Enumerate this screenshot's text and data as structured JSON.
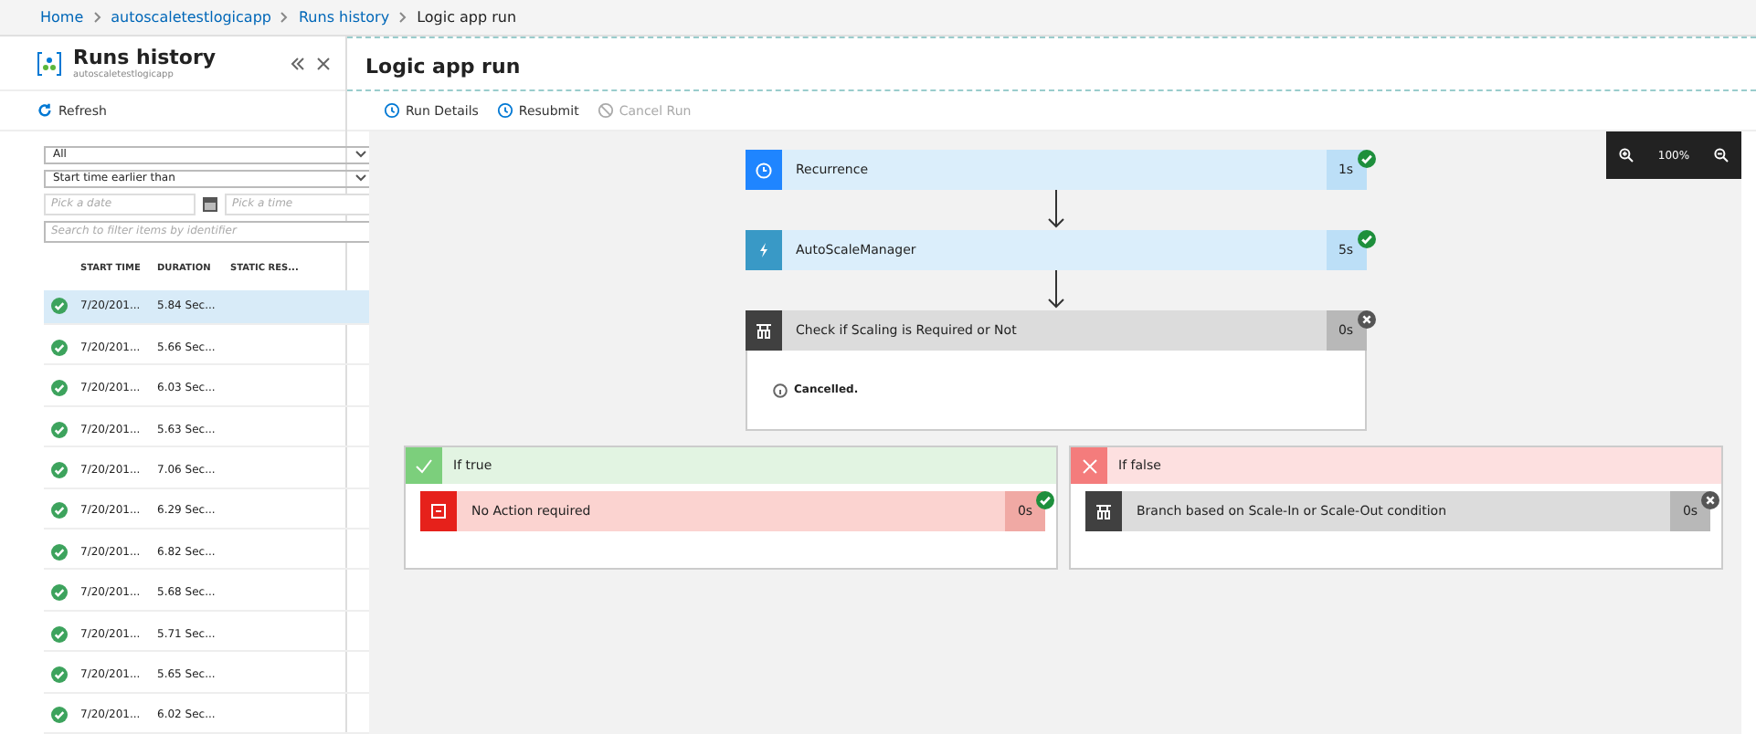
{
  "breadcrumb": [
    "Home",
    "autoscaletestlogicapp",
    "Runs history",
    "Logic app run"
  ],
  "left": {
    "title": "Runs history",
    "subtitle": "autoscaletestlogicapp",
    "refresh": "Refresh",
    "status_filter": "All",
    "time_filter": "Start time earlier than",
    "date_placeholder": "Pick a date",
    "time_placeholder": "Pick a time",
    "search_placeholder": "Search to filter items by identifier",
    "columns": [
      "START TIME",
      "DURATION",
      "STATIC RES..."
    ],
    "runs": [
      {
        "start": "7/20/201...",
        "duration": "5.84 Sec...",
        "selected": true
      },
      {
        "start": "7/20/201...",
        "duration": "5.66 Sec...",
        "selected": false
      },
      {
        "start": "7/20/201...",
        "duration": "6.03 Sec...",
        "selected": false
      },
      {
        "start": "7/20/201...",
        "duration": "5.63 Sec...",
        "selected": false
      },
      {
        "start": "7/20/201...",
        "duration": "7.06 Sec...",
        "selected": false
      },
      {
        "start": "7/20/201...",
        "duration": "6.29 Sec...",
        "selected": false
      },
      {
        "start": "7/20/201...",
        "duration": "6.82 Sec...",
        "selected": false
      },
      {
        "start": "7/20/201...",
        "duration": "5.68 Sec...",
        "selected": false
      },
      {
        "start": "7/20/201...",
        "duration": "5.71 Sec...",
        "selected": false
      },
      {
        "start": "7/20/201...",
        "duration": "5.65 Sec...",
        "selected": false
      },
      {
        "start": "7/20/201...",
        "duration": "6.02 Sec...",
        "selected": false
      }
    ]
  },
  "main": {
    "title": "Logic app run",
    "toolbar": [
      {
        "label": "Run Details",
        "disabled": false
      },
      {
        "label": "Resubmit",
        "disabled": false
      },
      {
        "label": "Cancel Run",
        "disabled": true
      }
    ],
    "zoom": "100%",
    "steps": [
      {
        "kind": "trigger",
        "name": "Recurrence",
        "duration": "1s",
        "succeeded": true
      },
      {
        "kind": "action",
        "name": "AutoScaleManager",
        "duration": "5s",
        "succeeded": true
      },
      {
        "kind": "condition",
        "name": "Check if Scaling is Required or Not",
        "duration": "0s",
        "succeeded": false,
        "message": "Cancelled."
      }
    ],
    "branches": [
      {
        "kind": "true",
        "label": "If true",
        "step": {
          "kind": "terminate",
          "name": "No Action required",
          "duration": "0s",
          "succeeded": true
        }
      },
      {
        "kind": "false",
        "label": "If false",
        "step": {
          "kind": "condition",
          "name": "Branch based on Scale-In or Scale-Out condition",
          "duration": "0s",
          "succeeded": false
        }
      }
    ]
  }
}
